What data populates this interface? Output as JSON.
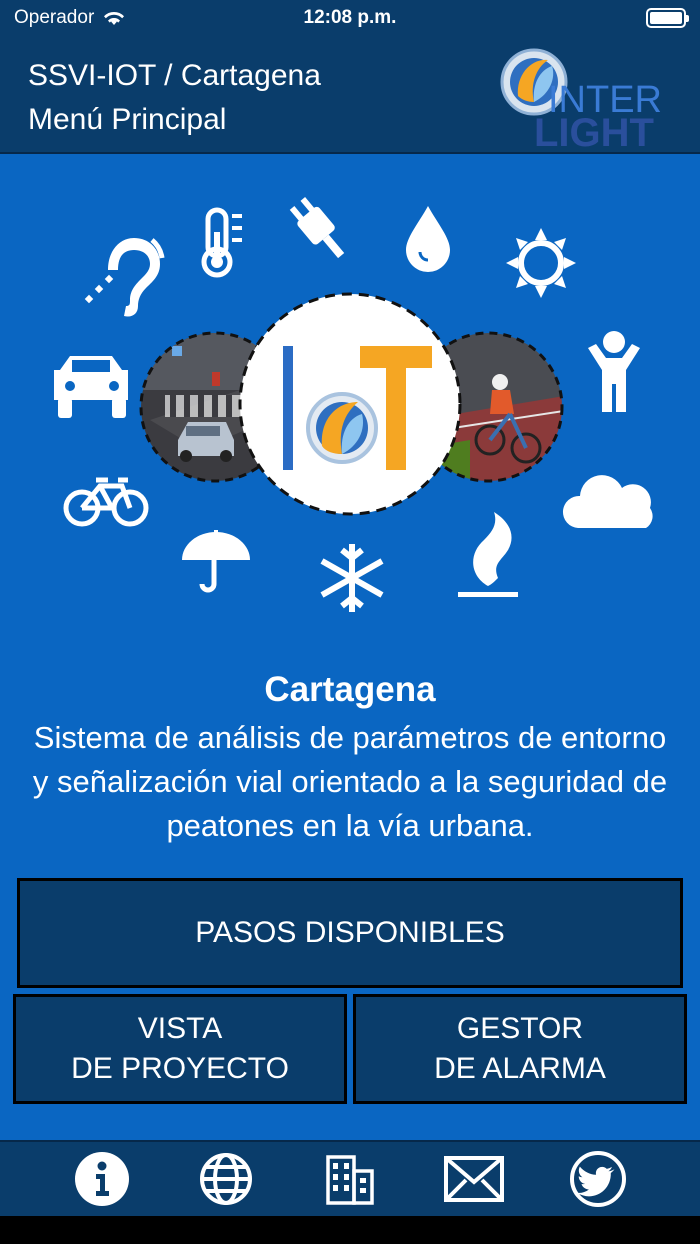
{
  "status_bar": {
    "carrier": "Operador",
    "time": "12:08 p.m."
  },
  "header": {
    "line1": "SSVI-IOT / Cartagena",
    "line2": "Menú Principal",
    "logo_text_top": "INTER",
    "logo_text_bottom": "LIGHT"
  },
  "hero": {
    "center_logo_letters": [
      "I",
      "T"
    ]
  },
  "content": {
    "title": "Cartagena",
    "description": "Sistema de análisis de parámetros de entorno y señalización vial orientado a la seguridad de peatones en la vía urbana."
  },
  "buttons": {
    "pasos": "PASOS DISPONIBLES",
    "vista_line1": "VISTA",
    "vista_line2": "DE PROYECTO",
    "gestor_line1": "GESTOR",
    "gestor_line2": "DE ALARMA"
  },
  "tabbar": {
    "icons": [
      "info-icon",
      "globe-icon",
      "building-icon",
      "mail-icon",
      "twitter-icon"
    ]
  },
  "colors": {
    "background": "#0a66c2",
    "bar": "#0a3d6b",
    "accent_orange": "#f5a623",
    "accent_blue": "#2b6cc4"
  }
}
